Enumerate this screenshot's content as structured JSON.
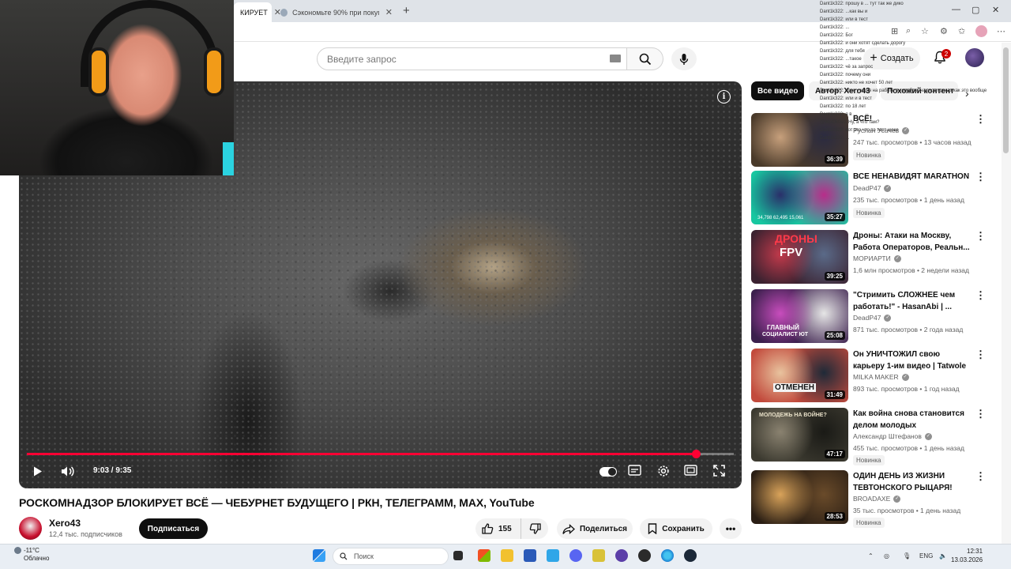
{
  "browser": {
    "tabs": [
      {
        "label": "КИРУЕТ"
      },
      {
        "label": "Сэкономьте 90% при покупке fo"
      }
    ],
    "new_tab": "+",
    "win_min": "—",
    "win_max": "▢",
    "win_close": "✕",
    "notif_count": "2"
  },
  "yt_header": {
    "search_placeholder": "Введите запрос",
    "create_label": "Создать",
    "create_plus": "+",
    "notif_count": "2"
  },
  "player": {
    "current_time": "9:03",
    "total_time": "9:35",
    "time_display": "9:03 / 9:35",
    "progress": 0.946
  },
  "video": {
    "title": "РОСКОМНАДЗОР БЛОКИРУЕТ ВСЁ — ЧЕБУРНЕТ БУДУЩЕГО | РКН, ТЕЛЕГРАММ, MAX, YouTube",
    "channel": "Xero43",
    "subscribers": "12,4 тыс. подписчиков",
    "subscribe_label": "Подписаться",
    "likes": "155",
    "share_label": "Поделиться",
    "save_label": "Сохранить",
    "more_label": "•••"
  },
  "chips": [
    {
      "label": "Все видео"
    },
    {
      "label": "Автор: Xero43"
    },
    {
      "label": "Похожий контент"
    }
  ],
  "recommendations": [
    {
      "title": "ВСЁ!",
      "channel": "Руслан Усачев",
      "meta": "247 тыс. просмотров • 13 часов назад",
      "badge": "Новинка",
      "duration": "36:39",
      "colors": [
        "#4a3a2a",
        "#c7a07c",
        "#2b2b40"
      ]
    },
    {
      "title": "ВСЕ НЕНАВИДЯТ MARATHON",
      "channel": "DeadP47",
      "meta": "235 тыс. просмотров • 1 день назад",
      "badge": "Новинка",
      "duration": "35:27",
      "colors": [
        "#17c7a0",
        "#2a2f6a",
        "#b82d8a"
      ]
    },
    {
      "title": "Дроны: Атаки на Москву, Работа Операторов, Реальн...",
      "channel": "МОРИАРТИ",
      "meta": "1,6 млн просмотров • 2 недели назад",
      "badge": "",
      "duration": "39:25",
      "colors": [
        "#3b2230",
        "#c23a4b",
        "#5a6a88"
      ]
    },
    {
      "title": "\"Стримить СЛОЖНЕЕ чем работать!\" - HasanAbi | ...",
      "channel": "DeadP47",
      "meta": "871 тыс. просмотров • 2 года назад",
      "badge": "",
      "duration": "25:08",
      "colors": [
        "#3b1f4d",
        "#c84dbd",
        "#e6e6e6"
      ]
    },
    {
      "title": "Он УНИЧТОЖИЛ свою карьеру 1-им видео | Tatwole",
      "channel": "MILKA MAKER",
      "meta": "893 тыс. просмотров • 1 год назад",
      "badge": "",
      "duration": "31:49",
      "colors": [
        "#c24a3c",
        "#e8c39e",
        "#1f2a38"
      ]
    },
    {
      "title": "Как война снова становится делом молодых",
      "channel": "Александр Штефанов",
      "meta": "455 тыс. просмотров • 1 день назад",
      "badge": "Новинка",
      "duration": "47:17",
      "colors": [
        "#3c3a30",
        "#8a8270",
        "#1a1a16"
      ]
    },
    {
      "title": "ОДИН ДЕНЬ ИЗ ЖИЗНИ ТЕВТОНСКОГО РЫЦАРЯ!",
      "channel": "BROADAXE",
      "meta": "35 тыс. просмотров • 1 день назад",
      "badge": "Новинка",
      "duration": "28:53",
      "colors": [
        "#2a1e14",
        "#d9a35a",
        "#6a4b2a"
      ]
    }
  ],
  "thumb_texts": {
    "r1": "ДРОНЫ",
    "r1b": "FPV",
    "r3": "ГЛАВНЫЙ",
    "r3b": "СОЦИАЛИСТ ЮТ",
    "r4": "ОТМЕНЕН",
    "r5": "МОЛОДЕЖЬ НА ВОЙНЕ?",
    "r1stats": "34,798   62,495   15,061"
  },
  "chat_overlay": [
    "Dant1k322: прошу в ... тут так же дико",
    "Dant1k322: ...как вы и",
    "Dant1k322: или в тест",
    "Dant1k322: ...",
    "Dant1k322: Бог",
    "Dant1k322: и они хотят сделать дорогу",
    "Dant1k322: для тебя",
    "Dant1k322: ...такое",
    "Dant1k322: чё за запрос",
    "Dant1k322: почему они",
    "Dant1k322: никто не хочет 50 лет",
    "Dant1k322: срок у меня на работе в корабле, на этот приказ как это вообще",
    "Dant1k322: или и в тест",
    "Dant1k322: по 18 лет",
    "Dant1k322: я в ...",
    "@Wet0k0s0: Ну, а что там?",
    "Dant1k322: вот это что то тест ниже",
    "Dant1k322: ...",
    "Dant1k322: Тема ...",
    "Dant1k322: ..."
  ],
  "taskbar": {
    "temp": "-11°C",
    "weather": "Облачно",
    "search": "Поиск",
    "lang": "ENG",
    "time": "12:31",
    "date": "13.03.2026"
  }
}
